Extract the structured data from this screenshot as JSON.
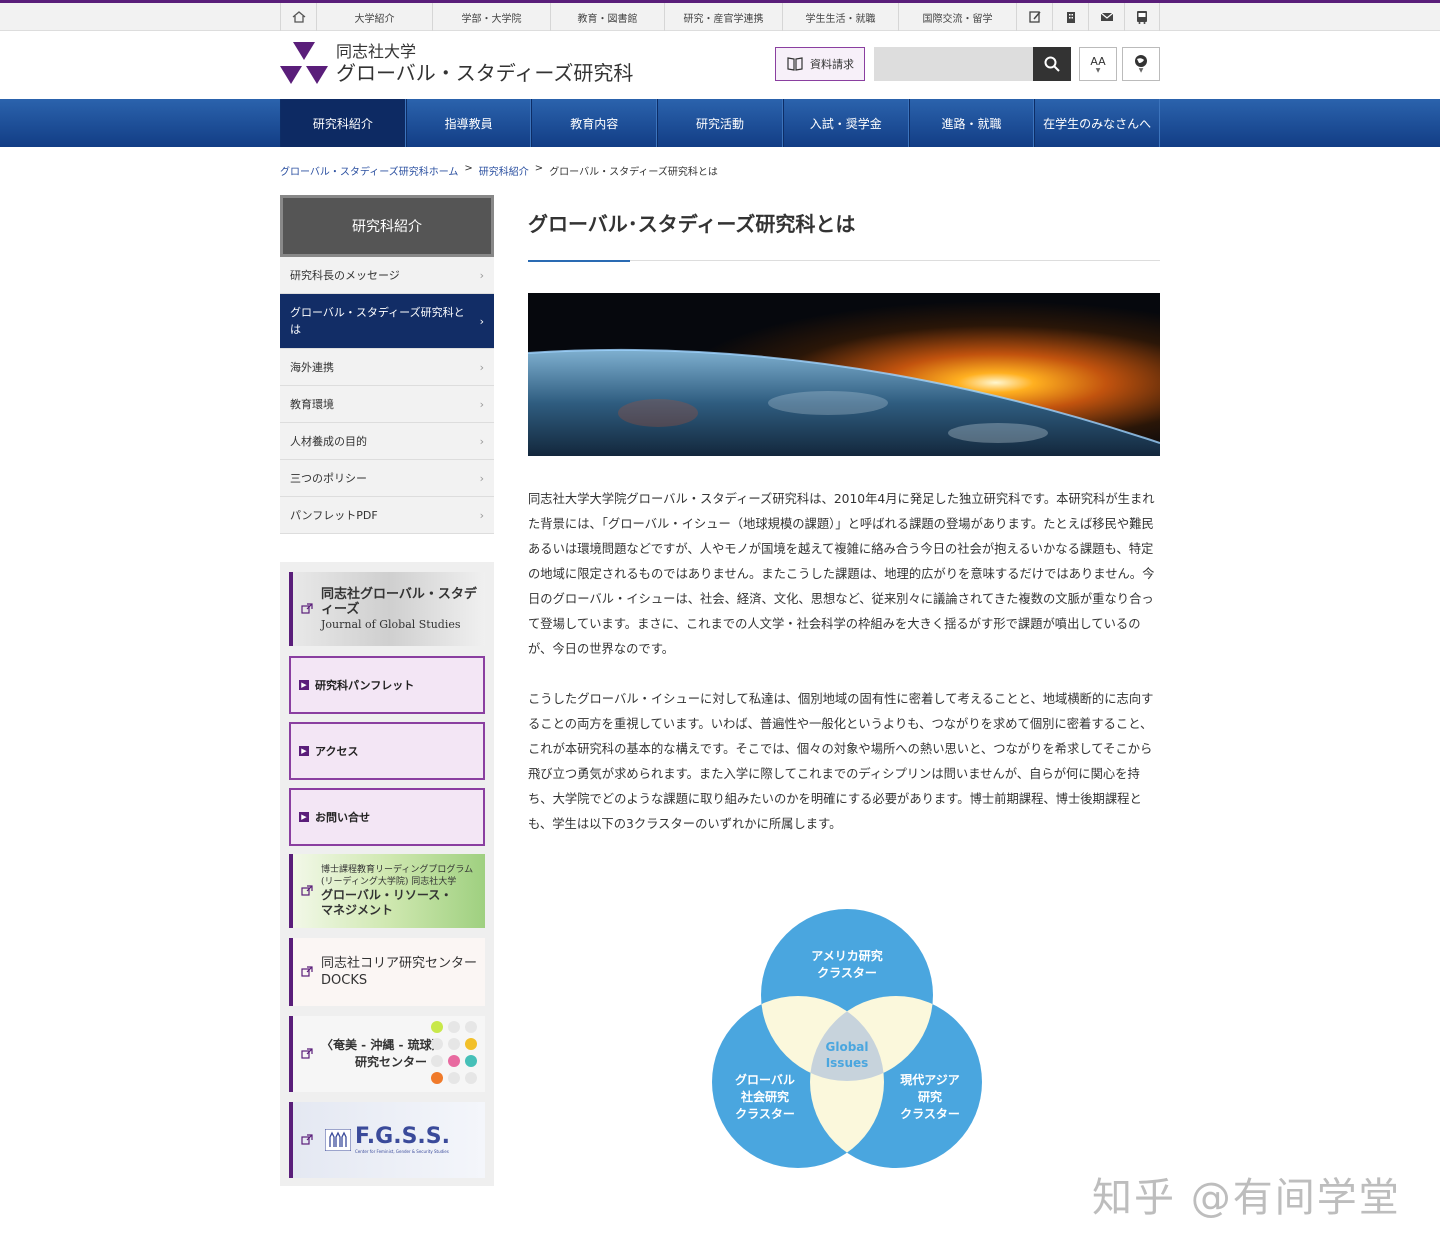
{
  "utility_nav": {
    "items": [
      "大学紹介",
      "学部・大学院",
      "教育・図書館",
      "研究・産官学連携",
      "学生生活・就職",
      "国際交流・留学"
    ]
  },
  "header": {
    "university": "同志社大学",
    "graduate_school": "グローバル・スタディーズ研究科",
    "request_label": "資料請求",
    "font_size_label": "AA"
  },
  "main_nav": {
    "items": [
      "研究科紹介",
      "指導教員",
      "教育内容",
      "研究活動",
      "入試・奨学金",
      "進路・就職",
      "在学生のみなさんへ"
    ]
  },
  "breadcrumb": {
    "home": "グローバル・スタディーズ研究科ホーム",
    "section": "研究科紹介",
    "current": "グローバル・スタディーズ研究科とは"
  },
  "sidebar": {
    "heading": "研究科紹介",
    "items": [
      "研究科長のメッセージ",
      "グローバル・スタディーズ研究科とは",
      "海外連携",
      "教育環境",
      "人材養成の目的",
      "三つのポリシー",
      "パンフレットPDF"
    ]
  },
  "banners": {
    "journal_title": "同志社グローバル・スタディーズ",
    "journal_sub": "Journal of Global Studies",
    "pamphlet": "研究科パンフレット",
    "access": "アクセス",
    "contact": "お問い合せ",
    "leading_line1": "博士課程教育リーディングプログラム",
    "leading_line2": "(リーディング大学院) 同志社大学",
    "leading_title1": "グローバル・リソース・",
    "leading_title2": "マネジメント",
    "korea_line1": "同志社コリア研究センター",
    "korea_line2": "DOCKS",
    "amami_line1": "〈奄美 - 沖縄 - 琉球〉",
    "amami_line2": "研究センター",
    "fgss_title": "F.G.S.S.",
    "fgss_sub": "Center for Feminist, Gender & Security Studies"
  },
  "main": {
    "title": "グローバル･スタディーズ研究科とは",
    "paragraph1": "同志社大学大学院グローバル・スタディーズ研究科は、2010年4月に発足した独立研究科です。本研究科が生まれた背景には、「グローバル・イシュー（地球規模の課題）」と呼ばれる課題の登場があります。たとえば移民や難民あるいは環境問題などですが、人やモノが国境を越えて複雑に絡み合う今日の社会が抱えるいかなる課題も、特定の地域に限定されるものではありません。またこうした課題は、地理的広がりを意味するだけではありません。今日のグローバル・イシューは、社会、経済、文化、思想など、従来別々に議論されてきた複数の文脈が重なり合って登場しています。まさに、これまでの人文学・社会科学の枠組みを大きく揺るがす形で課題が噴出しているのが、今日の世界なのです。",
    "paragraph2": "こうしたグローバル・イシューに対して私達は、個別地域の固有性に密着して考えることと、地域横断的に志向することの両方を重視しています。いわば、普遍性や一般化というよりも、つながりを求めて個別に密着すること、これが本研究科の基本的な構えです。そこでは、個々の対象や場所への熱い思いと、つながりを希求してそこから飛び立つ勇気が求められます。また入学に際してこれまでのディシプリンは問いませんが、自らが何に関心を持ち、大学院でどのような課題に取り組みたいのかを明確にする必要があります。博士前期課程、博士後期課程とも、学生は以下の3クラスターのいずれかに所属します。"
  },
  "venn": {
    "top_line1": "アメリカ研究",
    "top_line2": "クラスター",
    "left_line1": "グローバル",
    "left_line2": "社会研究",
    "left_line3": "クラスター",
    "right_line1": "現代アジア",
    "right_line2": "研究",
    "right_line3": "クラスター",
    "center_line1": "Global",
    "center_line2": "Issues"
  },
  "watermark": "知乎 @有间学堂",
  "colors": {
    "brand_purple": "#5a1e7a",
    "nav_blue": "#1b4a93",
    "sidebar_active": "#122d66",
    "venn_blue": "#4aa6df"
  }
}
